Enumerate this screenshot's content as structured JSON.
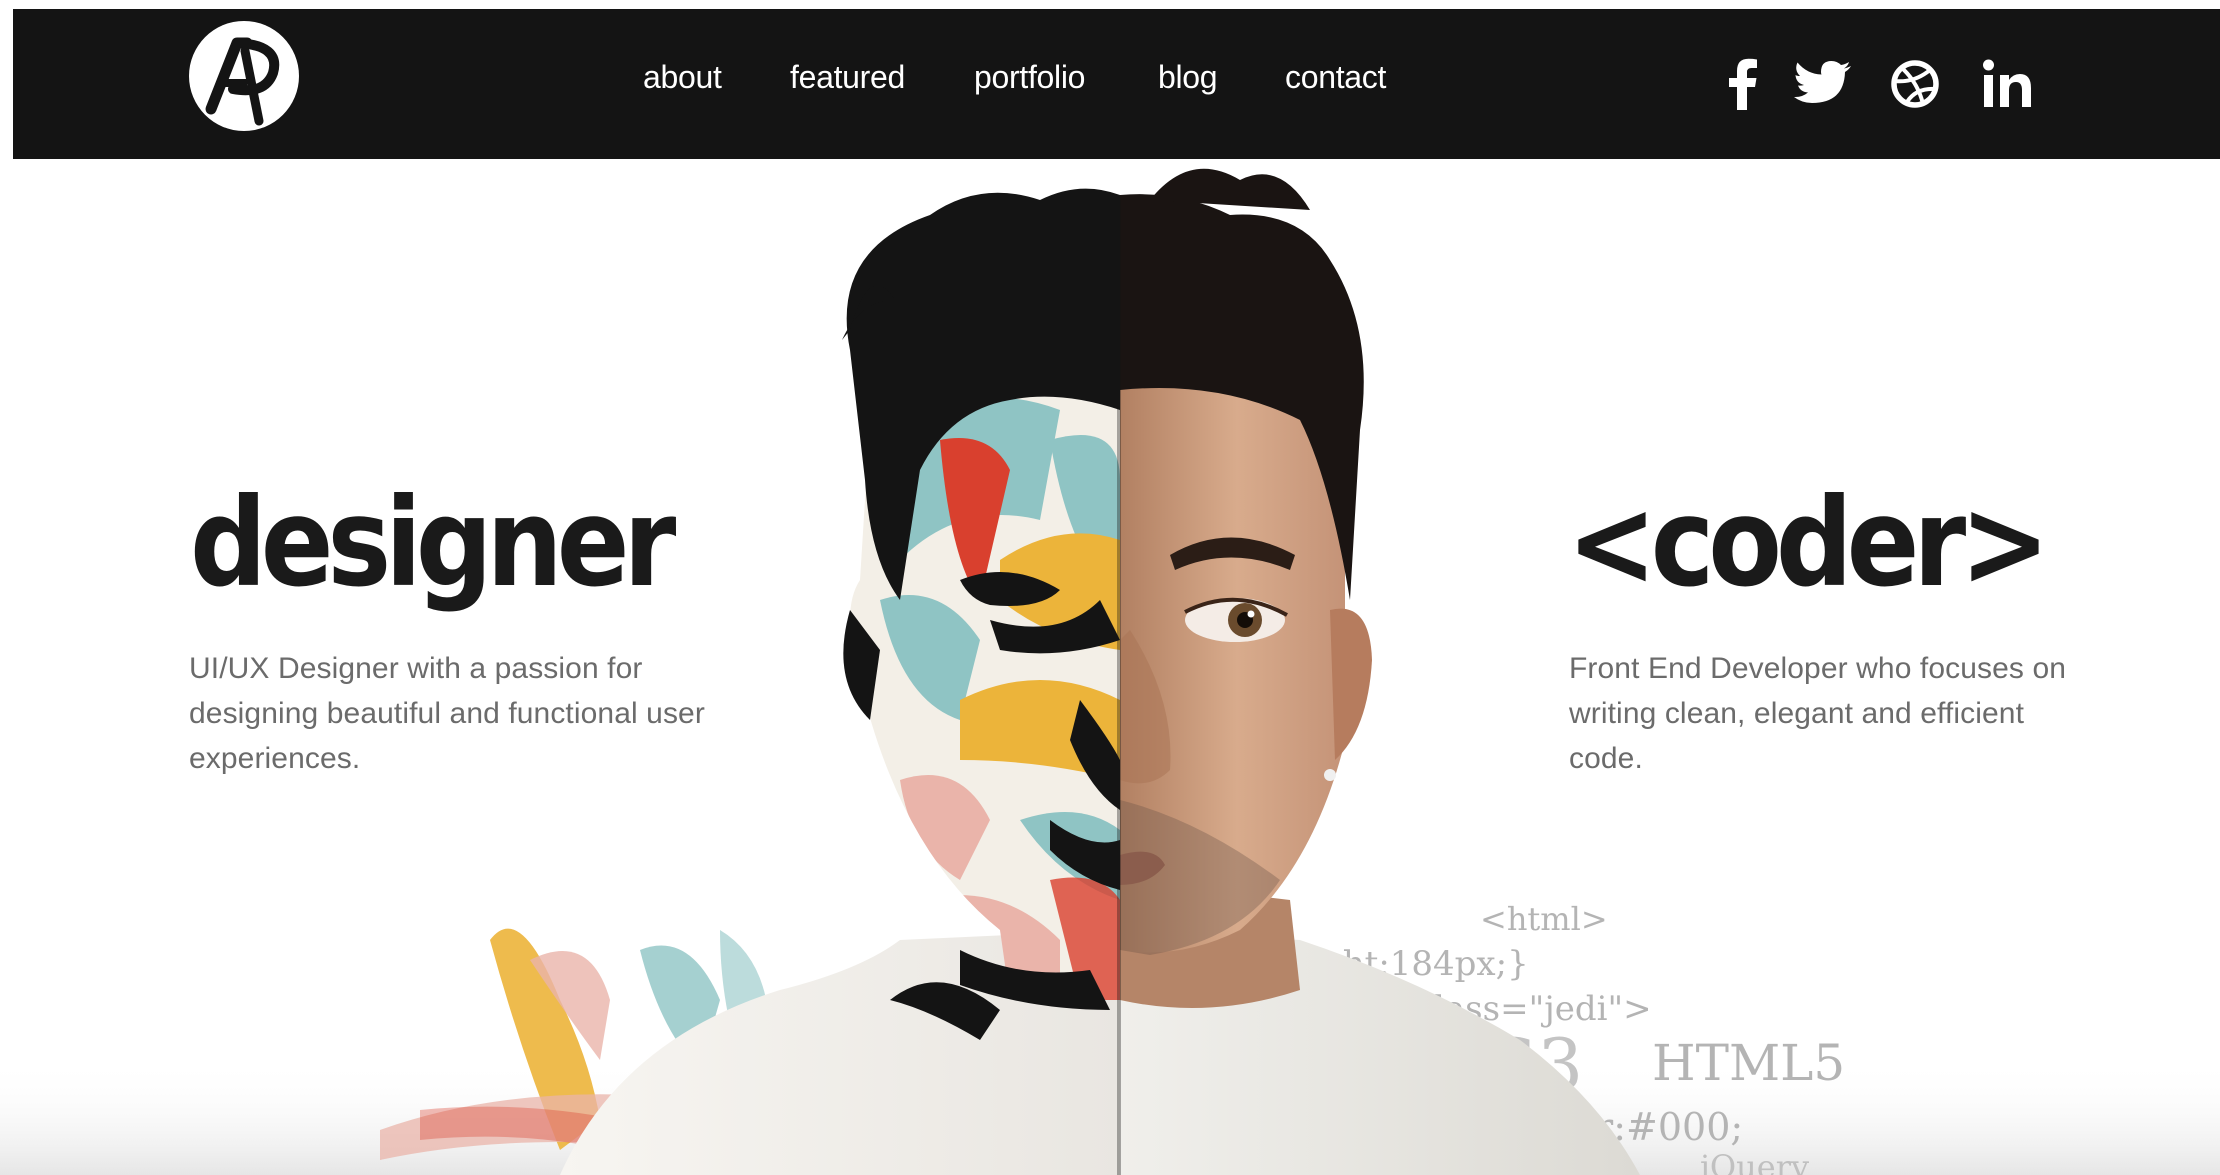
{
  "nav": {
    "logo": "AP",
    "links": [
      "about",
      "featured",
      "portfolio",
      "blog",
      "contact"
    ],
    "social": [
      {
        "icon": "facebook-icon",
        "glyph": "f"
      },
      {
        "icon": "twitter-icon",
        "glyph": "bird"
      },
      {
        "icon": "dribbble-icon",
        "glyph": "ball"
      },
      {
        "icon": "linkedin-icon",
        "glyph": "in"
      }
    ]
  },
  "hero": {
    "designer": {
      "title": "designer",
      "description": "UI/UX Designer with a passion for designing beautiful and functional user experiences."
    },
    "coder": {
      "title": "<coder>",
      "description": "Front End Developer who focuses on writing clean, elegant and efficient code."
    },
    "code_snippets": [
      "<html>",
      "eight:184px;}",
      "class=\"jedi\">",
      "SS3",
      "HTML5",
      "lor:#000;",
      "jQuery"
    ]
  },
  "colors": {
    "navbar": "#141414",
    "headline": "#1a1a1a",
    "body_text": "#6b6b6b",
    "code_text": "#b4b4b4",
    "paint_teal": "#8fc4c4",
    "paint_yellow": "#ecb43a",
    "paint_red": "#d9402e",
    "paint_pink": "#eab4aa"
  }
}
